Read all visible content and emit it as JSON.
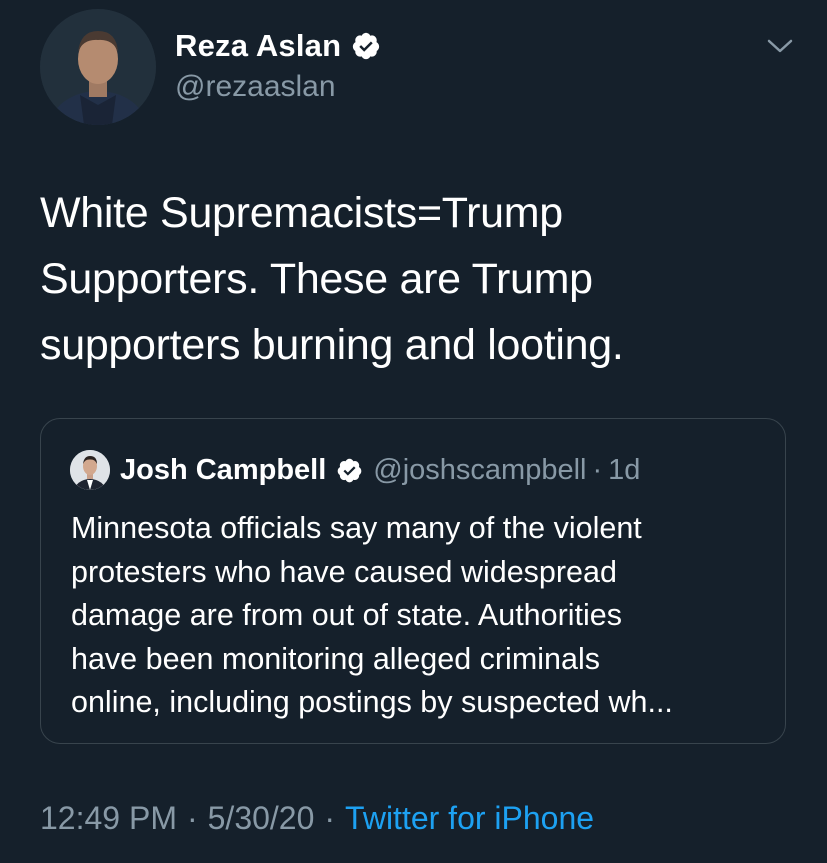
{
  "colors": {
    "background": "#15202b",
    "muted": "#8899a6",
    "accent": "#1da1f2",
    "border": "#38444d"
  },
  "author": {
    "name": "Reza Aslan",
    "handle": "@rezaaslan",
    "verified_icon": "verified-badge-icon"
  },
  "menu_icon": "chevron-down-icon",
  "tweet": {
    "lines": [
      "White Supremacists=Trump",
      "Supporters. These are Trump",
      "supporters burning and looting."
    ]
  },
  "quote": {
    "name": "Josh Campbell",
    "handle": "@joshscampbell",
    "separator": "·",
    "time": "1d",
    "lines": [
      "Minnesota officials say many of the violent",
      "protesters who have caused widespread",
      "damage are from out of state. Authorities",
      "have been monitoring alleged criminals",
      "online, including postings by suspected wh..."
    ]
  },
  "footer": {
    "time": "12:49 PM",
    "separator": "·",
    "date": "5/30/20",
    "source": "Twitter for iPhone"
  }
}
